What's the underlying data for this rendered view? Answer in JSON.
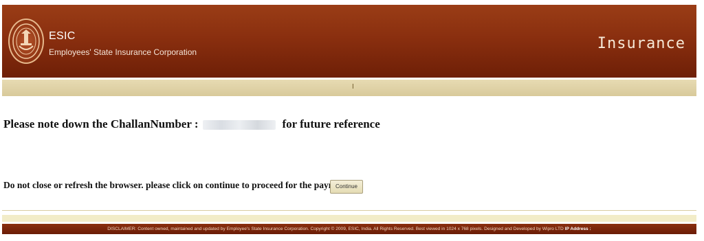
{
  "header": {
    "org_abbr": "ESIC",
    "org_name": "Employees' State Insurance Corporation",
    "brand": "Insurance"
  },
  "subbar": {
    "marker": "I"
  },
  "message": {
    "prefix": "Please note down the ChallanNumber :",
    "suffix": "for future reference"
  },
  "notice": {
    "text": "Do not close or refresh the browser. please click on continue to proceed for the payment",
    "continue_label": "Continue"
  },
  "footer": {
    "text": "DISCLAIMER: Content owned, maintained and updated by Employee's State Insurance Corporation. Copyright © 2009, ESIC, India. All Rights Reserved. Best viewed in 1024 x 768 pixels. Designed and Developed by Wipro LTD",
    "ip_label": "IP Address :"
  },
  "colors": {
    "header_bg": "#8a2f0f",
    "subbar_bg": "#d8c99a",
    "button_bg": "#e5dcb4"
  }
}
